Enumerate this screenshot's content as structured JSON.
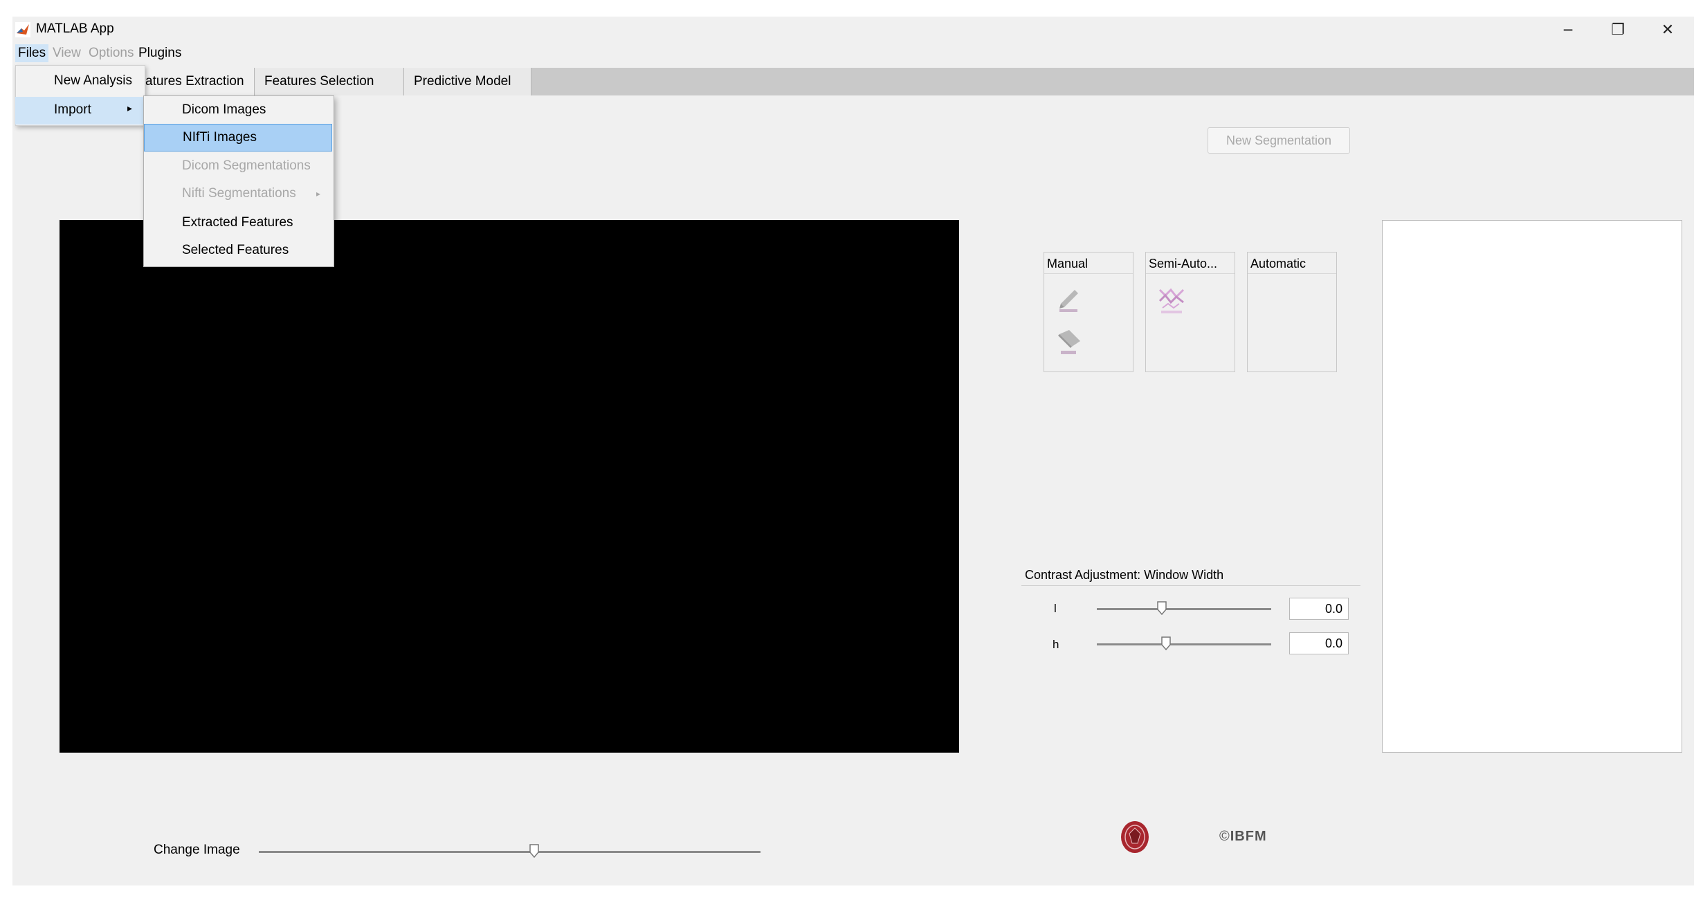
{
  "window": {
    "title": "MATLAB App",
    "controls": {
      "minimize": "−",
      "restore": "❐",
      "close": "✕"
    }
  },
  "menubar": {
    "items": [
      {
        "label": "Files",
        "enabled": true,
        "active": true
      },
      {
        "label": "View",
        "enabled": false
      },
      {
        "label": "Options",
        "enabled": false
      },
      {
        "label": "Plugins",
        "enabled": true
      }
    ]
  },
  "files_menu": {
    "items": [
      {
        "label": "New Analysis"
      },
      {
        "label": "Import",
        "has_submenu": true,
        "submenu_arrow": "▸"
      }
    ]
  },
  "import_menu": {
    "items": [
      {
        "label": "Dicom Images",
        "enabled": true
      },
      {
        "label": "NIfTi Images",
        "enabled": true,
        "highlighted": true
      },
      {
        "label": "Dicom Segmentations",
        "enabled": false
      },
      {
        "label": "Nifti Segmentations",
        "enabled": false,
        "submenu_arrow": "▸"
      },
      {
        "label": "Extracted Features",
        "enabled": true
      },
      {
        "label": "Selected Features",
        "enabled": true
      }
    ]
  },
  "tabs": [
    {
      "label": "atures Extraction"
    },
    {
      "label": "Features Selection"
    },
    {
      "label": "Predictive Model"
    }
  ],
  "segmentation": {
    "new_button": "New Segmentation",
    "panels": [
      {
        "title": "Manual",
        "tools": [
          "draw-icon",
          "erase-icon"
        ]
      },
      {
        "title": "Semi-Auto...",
        "tools": [
          "threshold-icon"
        ]
      },
      {
        "title": "Automatic",
        "tools": []
      }
    ]
  },
  "contrast": {
    "title": "Contrast Adjustment: Window Width",
    "sliders": [
      {
        "label": "l",
        "value": "0.0",
        "position": 0.4
      },
      {
        "label": "h",
        "value": "0.0",
        "position": 0.42
      }
    ]
  },
  "change_image": {
    "label": "Change Image",
    "position": 0.54
  },
  "logos": {
    "ibfm": "IBFM"
  },
  "colors": {
    "background": "#f0f0f0",
    "menu_highlight": "#cfe4f7",
    "submenu_highlight": "#a9d0f5",
    "image_axes": "#000000"
  }
}
